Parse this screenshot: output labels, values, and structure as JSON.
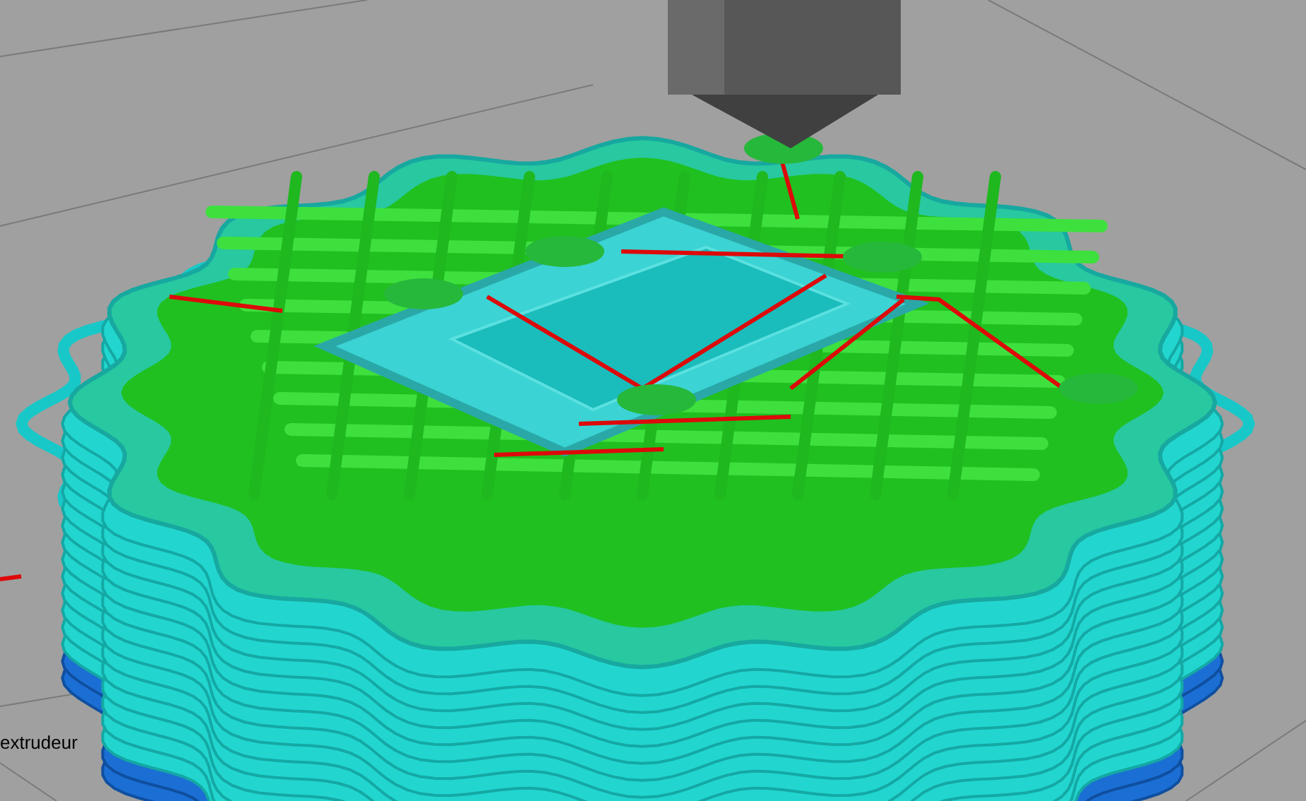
{
  "viewport": {
    "label": "extrudeur"
  }
}
